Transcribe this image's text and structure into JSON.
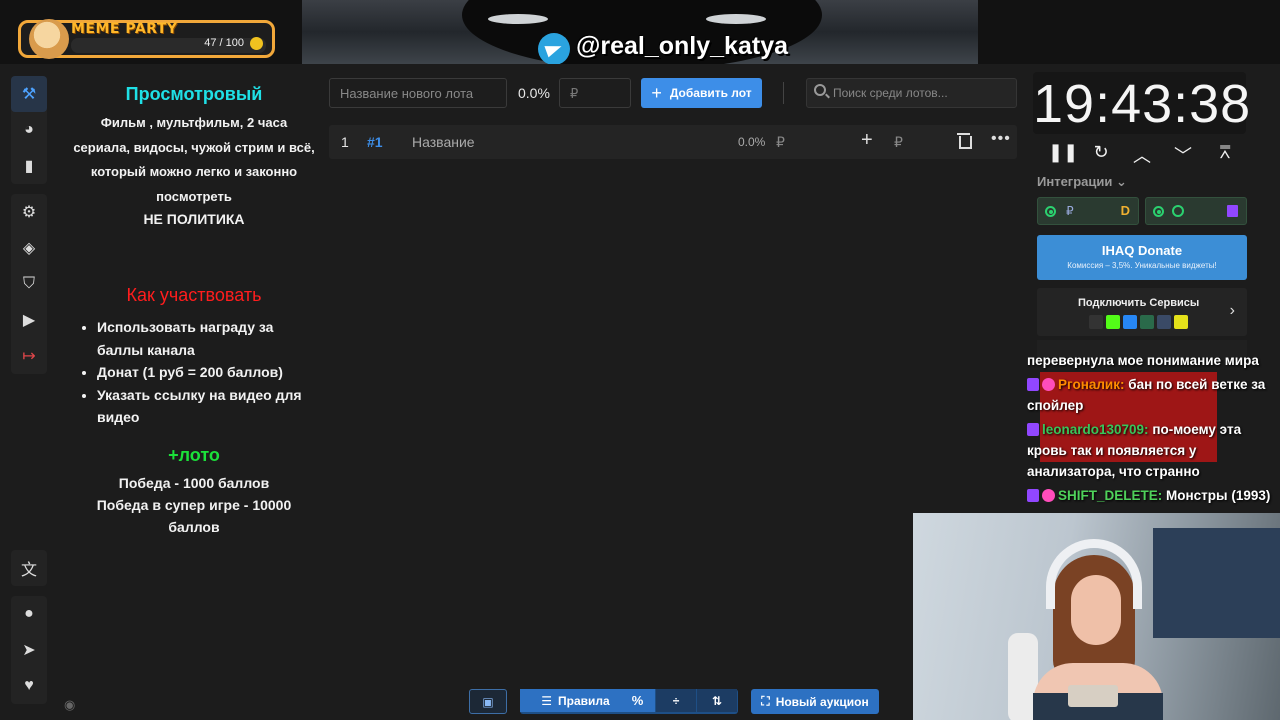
{
  "overlay": {
    "meme_title": "MEME PARTY",
    "meme_count": "47 / 100",
    "telegram_handle": "@real_only_katya"
  },
  "rules": {
    "title": "Просмотровый",
    "description": "Фильм , мультфильм, 2 часа сериала, видосы, чужой стрим и всё, который можно легко и законно посмотреть",
    "no_politics": "НЕ ПОЛИТИКА",
    "how_title": "Как участвовать",
    "how_items": [
      "Использовать награду за баллы канала",
      "Донат (1 руб = 200 баллов)",
      "Указать ссылку на видео для видео"
    ],
    "loto_title": "+лото",
    "loto_win": "Победа - 1000 баллов",
    "loto_super": "Победа в супер игре - 10000 баллов"
  },
  "lot_form": {
    "name_placeholder": "Название нового лота",
    "percent": "0.0%",
    "sum_placeholder": "₽",
    "add_label": "Добавить лот",
    "search_placeholder": "Поиск среди лотов..."
  },
  "lots": [
    {
      "num": "1",
      "id": "#1",
      "name": "Название",
      "percent": "0.0%",
      "currency": "₽"
    }
  ],
  "timer": {
    "value": "19:43:38"
  },
  "integrations": {
    "label": "Интеграции",
    "donate_title": "IHAQ Donate",
    "donate_sub": "Комиссия – 3,5%. Уникальные виджеты!",
    "services_title": "Подключить Сервисы",
    "currency": "₽"
  },
  "chat": [
    {
      "user": "",
      "text": "перевернула мое понимание мира"
    },
    {
      "user": "Ргоналик:",
      "text": "бан по всей ветке за спойлер"
    },
    {
      "user": "leonardo130709:",
      "text": "по-моему эта кровь так и появляется у анализатора, что странно"
    },
    {
      "user": "SHIFT_DELETE:",
      "text": "Монстры (1993)"
    }
  ],
  "toolbar": {
    "rules_label": "Правила",
    "new_auction_label": "Новый аукцион"
  }
}
